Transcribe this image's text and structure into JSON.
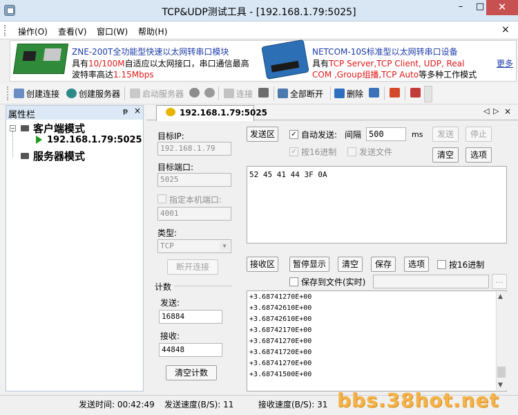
{
  "window": {
    "title": "TCP&UDP测试工具 - [192.168.1.79:5025]",
    "minimize": "–",
    "maximize": "□",
    "close": "✕"
  },
  "menu": [
    {
      "label": "操作(O)"
    },
    {
      "label": "查看(V)"
    },
    {
      "label": "窗口(W)"
    },
    {
      "label": "帮助(H)"
    }
  ],
  "menu_close": "×",
  "banner": {
    "ad1": {
      "title": "ZNE-200T全功能型快速以太网转串口模块",
      "line2_a": "具有",
      "line2_red": "10/100M",
      "line2_b": "自适应以太网接口，串口通信最高",
      "line3_a": "波特率高达",
      "line3_red": "1.15Mbps"
    },
    "ad2": {
      "title": "NETCOM-10S标准型以太网转串口设备",
      "line2_a": "具有",
      "line2_red": "TCP Server,TCP Client, UDP, Real",
      "line3_red": "COM ,Group组播,TCP Auto",
      "line3_b": "等多种工作模式"
    },
    "more": "更多"
  },
  "toolbar": {
    "create_connection": "创建连接",
    "create_server": "创建服务器",
    "start_server": "启动服务器",
    "connect": "连接",
    "disconnect_all": "全部断开",
    "delete": "删除"
  },
  "sidebar": {
    "title": "属性栏",
    "pin": "ᵽ",
    "close": "×",
    "tree": {
      "client_mode": "客户端模式",
      "client_item": "192.168.1.79:5025",
      "server_mode": "服务器模式"
    }
  },
  "tab": {
    "label": "192.168.1.79:5025"
  },
  "config": {
    "target_ip_label": "目标IP:",
    "target_ip": "192.168.1.79",
    "target_port_label": "目标端口:",
    "target_port": "5025",
    "local_port_label": "指定本机端口:",
    "local_port": "4001",
    "type_label": "类型:",
    "type_value": "TCP",
    "disconnect_button": "断开连接",
    "count_label": "计数",
    "send_label": "发送:",
    "send_count": "16884",
    "recv_label": "接收:",
    "recv_count": "44848",
    "clear_count_button": "清空计数"
  },
  "send_area": {
    "title": "发送区",
    "auto_send": "自动发送:",
    "interval_label": "间隔",
    "interval": "500",
    "unit": "ms",
    "send_button": "发送",
    "stop_button": "停止",
    "hex_label": "按16进制",
    "send_file_label": "发送文件",
    "clear_button": "清空",
    "options_button": "选项",
    "content": "52 45 41 44 3F 0A"
  },
  "recv_area": {
    "title": "接收区",
    "pause_button": "暂停显示",
    "clear_button": "清空",
    "save_button": "保存",
    "options_button": "选项",
    "hex_label": "按16进制",
    "save_to_file_label": "保存到文件(实时)",
    "browse_button": "...",
    "lines": [
      "+3.68741270E+00",
      "+3.68742610E+00",
      "+3.68742610E+00",
      "+3.68742170E+00",
      "+3.68741270E+00",
      "+3.68741720E+00",
      "+3.68741270E+00",
      "+3.68741500E+00"
    ]
  },
  "status": {
    "send_time": "发送时间: 00:42:49",
    "send_speed": "发送速度(B/S): 11",
    "recv_speed": "接收速度(B/S): 31"
  },
  "watermark": "bbs.38hot.net"
}
